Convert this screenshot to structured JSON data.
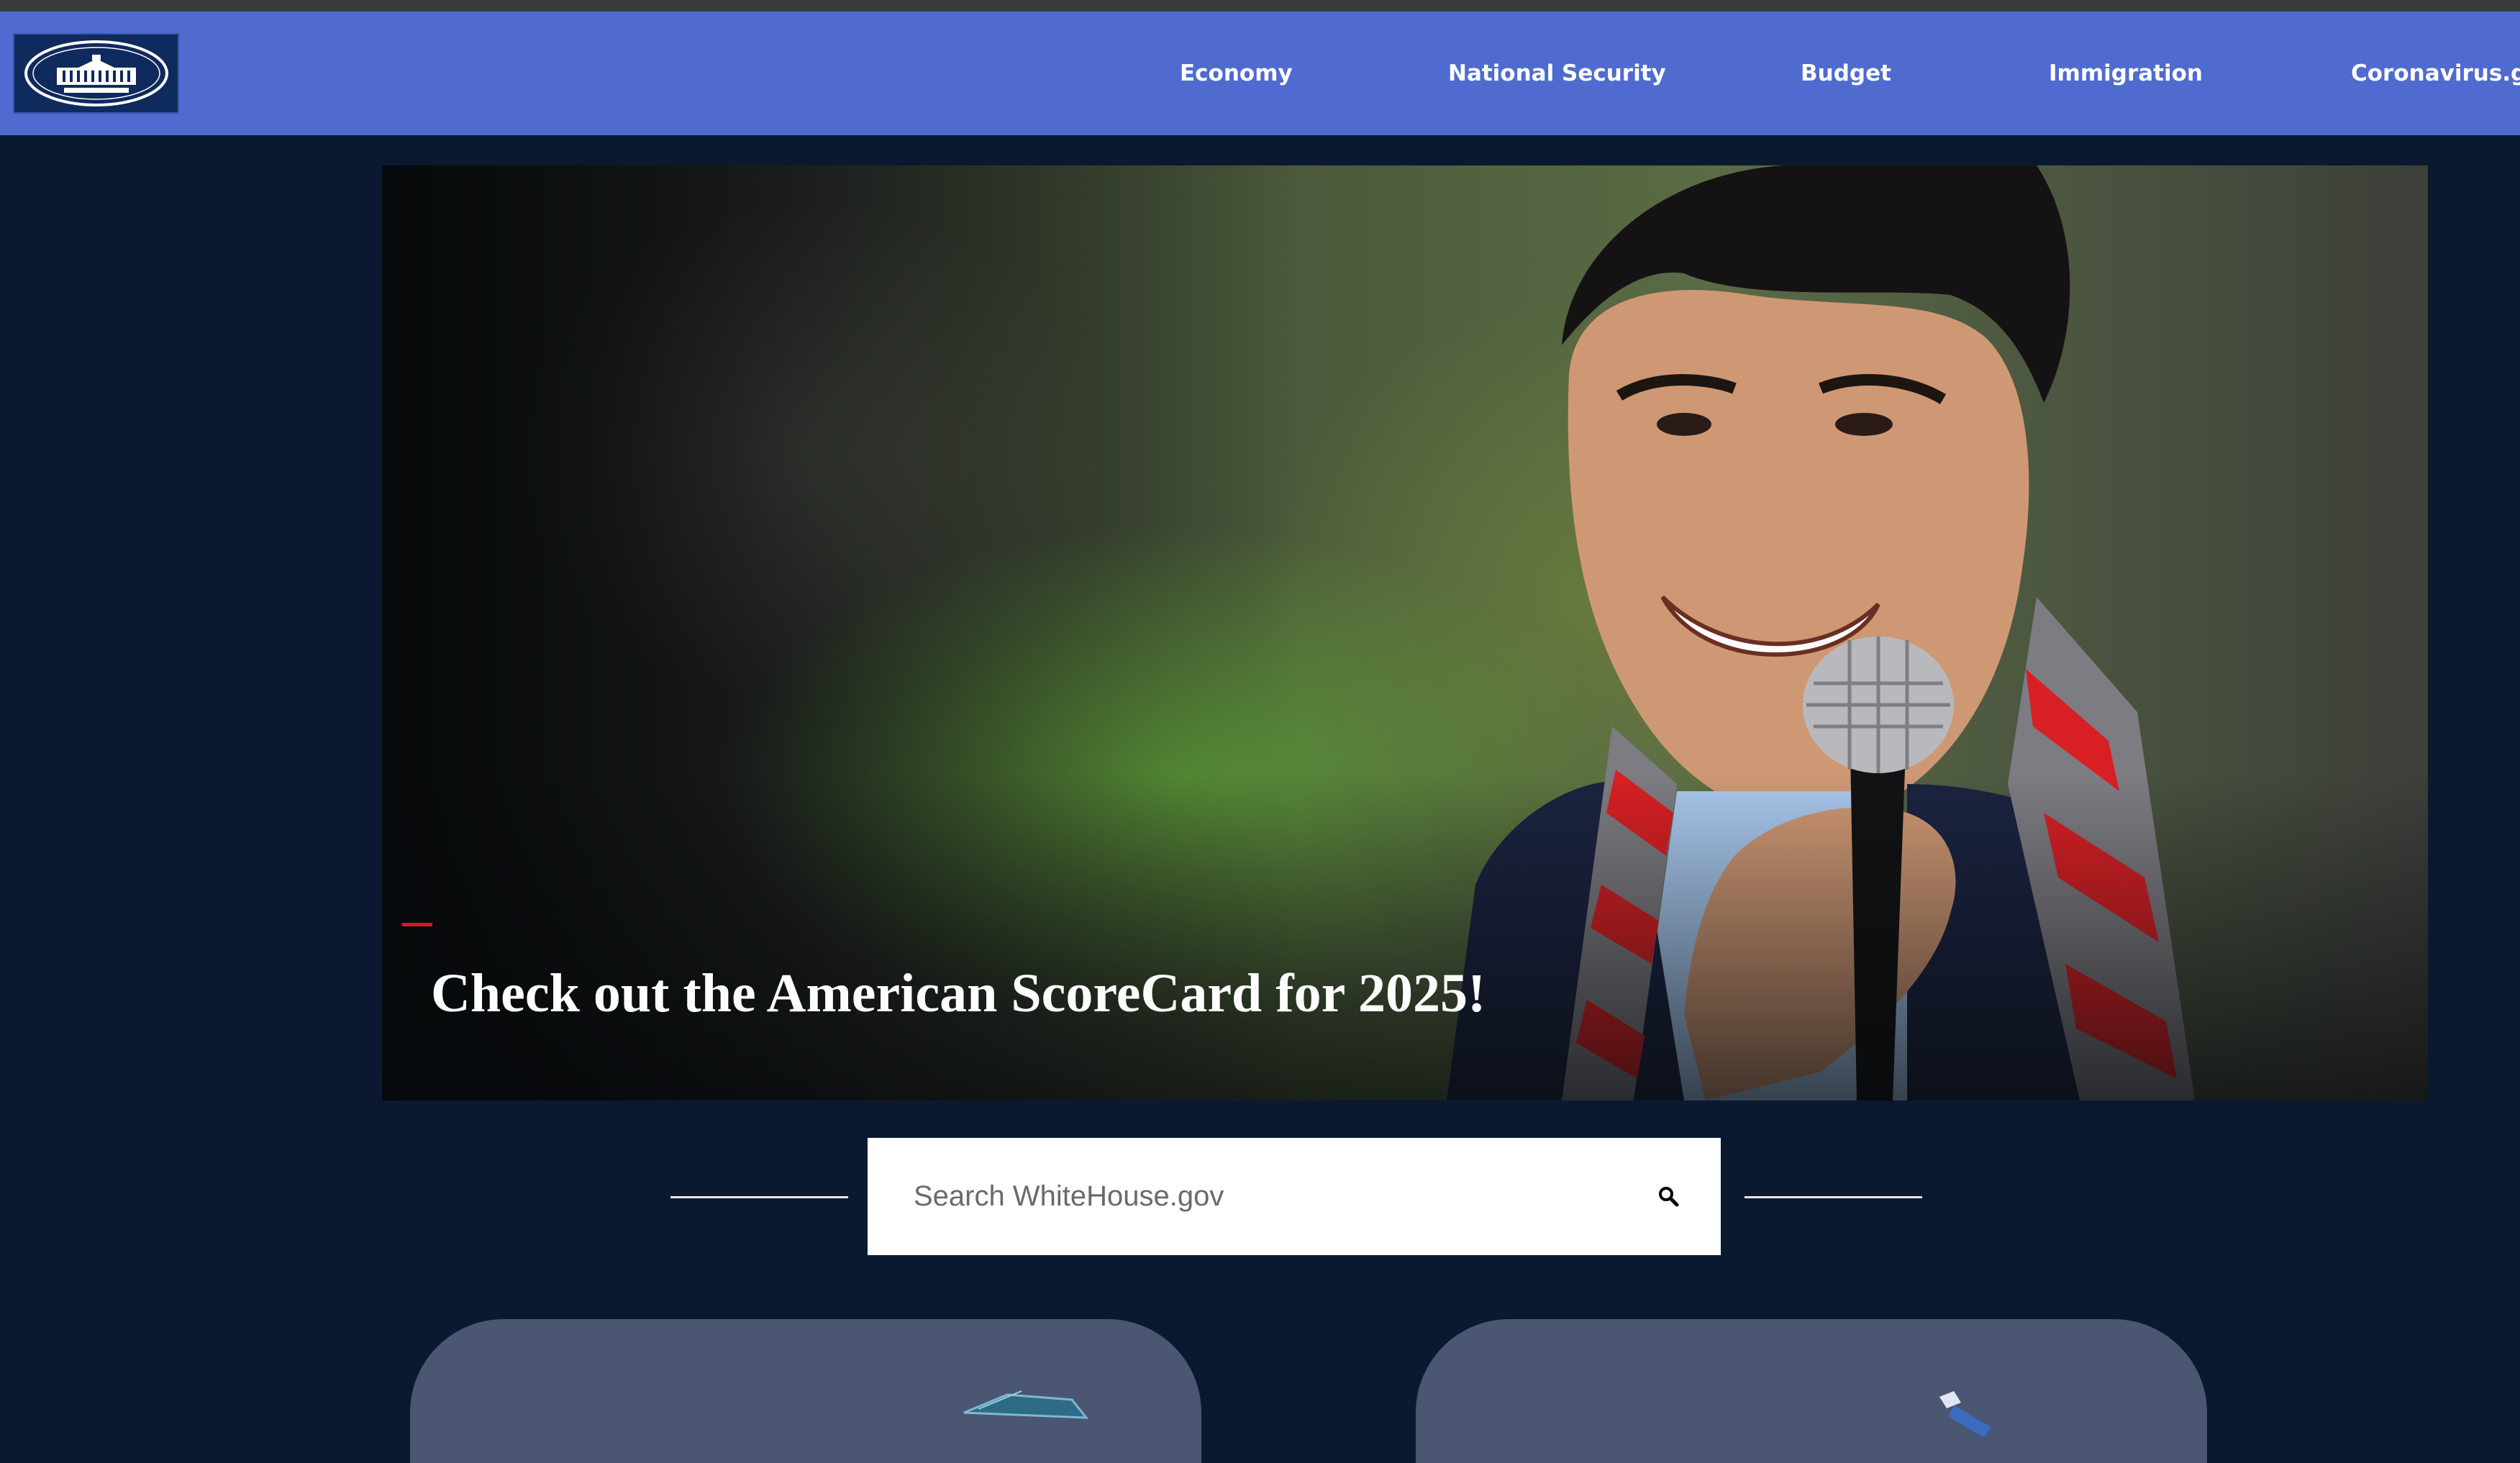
{
  "nav": {
    "logo_alt": "THE WHITE HOUSE",
    "items": [
      {
        "label": "Economy"
      },
      {
        "label": "National Security"
      },
      {
        "label": "Budget"
      },
      {
        "label": "Immigration"
      },
      {
        "label": "Coronavirus.gov"
      }
    ]
  },
  "hero": {
    "headline": "Check out the American ScoreCard for 2025!"
  },
  "search": {
    "placeholder": "Search WhiteHouse.gov",
    "icon": "search-icon"
  },
  "colors": {
    "page_bg": "#0b1930",
    "navbar": "#4f6bd0",
    "accent": "#d41b1b",
    "card": "#4a5672"
  }
}
